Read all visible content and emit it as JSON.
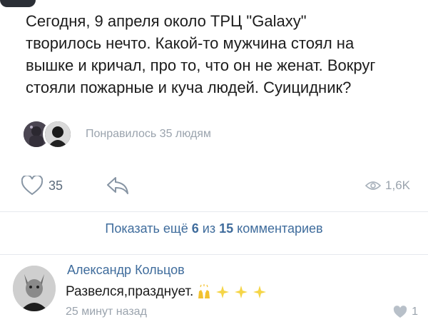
{
  "post": {
    "text": "Сегодня, 9 апреля около ТРЦ \"Galaxy\"\nтворилось нечто. Какой-то мужчина стоял на\nвышке и кричал, про то, что он не женат. Вокруг\nстояли пожарные и куча людей. Суицидник?"
  },
  "likes": {
    "summary": "Понравилось 35 людям"
  },
  "actions": {
    "like_count": "35",
    "views": "1,6K"
  },
  "comments_bar": {
    "prefix": "Показать ещё ",
    "shown": "6",
    "middle": " из ",
    "total": "15",
    "suffix": " комментариев"
  },
  "comment": {
    "author": "Александр Кольцов",
    "text": "Развелся,празднует.",
    "time": "25 минут назад",
    "likes": "1"
  },
  "colors": {
    "link_blue": "#3f6c9c",
    "muted_gray": "#9aa3ad"
  },
  "icons": {
    "like": "heart-icon",
    "share": "share-arrow-icon",
    "views": "eye-icon",
    "comment_like": "heart-filled-icon"
  }
}
